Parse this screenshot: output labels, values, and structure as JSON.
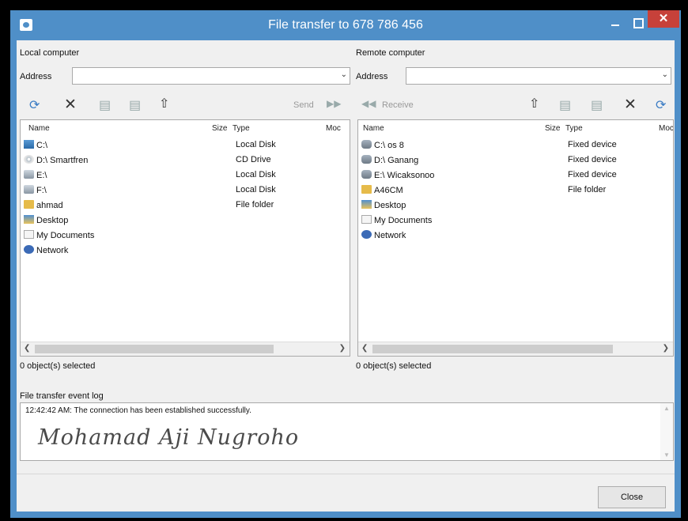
{
  "window": {
    "title": "File transfer to 678 786 456",
    "close_glyph": "✕"
  },
  "local": {
    "label": "Local computer",
    "address_label": "Address",
    "address_value": "",
    "send_label": "Send",
    "columns": [
      "Name",
      "Size",
      "Type",
      "Moc"
    ],
    "items": [
      {
        "name": "C:\\",
        "type": "Local Disk",
        "icon": "system-disk-icon"
      },
      {
        "name": "D:\\ Smartfren",
        "type": "CD Drive",
        "icon": "cd-drive-icon"
      },
      {
        "name": "E:\\",
        "type": "Local Disk",
        "icon": "disk-icon"
      },
      {
        "name": "F:\\",
        "type": "Local Disk",
        "icon": "disk-icon"
      },
      {
        "name": "ahmad",
        "type": "File folder",
        "icon": "folder-icon"
      },
      {
        "name": "Desktop",
        "type": "",
        "icon": "desktop-icon"
      },
      {
        "name": "My Documents",
        "type": "",
        "icon": "documents-icon"
      },
      {
        "name": "Network",
        "type": "",
        "icon": "network-icon"
      }
    ],
    "status": "0 object(s) selected"
  },
  "remote": {
    "label": "Remote computer",
    "address_label": "Address",
    "address_value": "",
    "receive_label": "Receive",
    "columns": [
      "Name",
      "Size",
      "Type",
      "Moc"
    ],
    "items": [
      {
        "name": "C:\\ os 8",
        "type": "Fixed device",
        "icon": "fixed-disk-icon"
      },
      {
        "name": "D:\\ Ganang",
        "type": "Fixed device",
        "icon": "fixed-disk-icon"
      },
      {
        "name": "E:\\ Wicaksonoo",
        "type": "Fixed device",
        "icon": "fixed-disk-icon"
      },
      {
        "name": "A46CM",
        "type": "File folder",
        "icon": "folder-icon"
      },
      {
        "name": "Desktop",
        "type": "",
        "icon": "desktop-icon"
      },
      {
        "name": "My Documents",
        "type": "",
        "icon": "documents-icon"
      },
      {
        "name": "Network",
        "type": "",
        "icon": "network-icon"
      }
    ],
    "status": "0 object(s) selected"
  },
  "log": {
    "label": "File transfer event log",
    "entries": [
      "12:42:42 AM: The connection has been established successfully."
    ],
    "signature": "Mohamad Aji Nugroho"
  },
  "buttons": {
    "close": "Close"
  },
  "colors": {
    "title_bar": "#4f8fc8",
    "close_button": "#c7413a",
    "toolbar_accent": "#3a7cc4"
  }
}
